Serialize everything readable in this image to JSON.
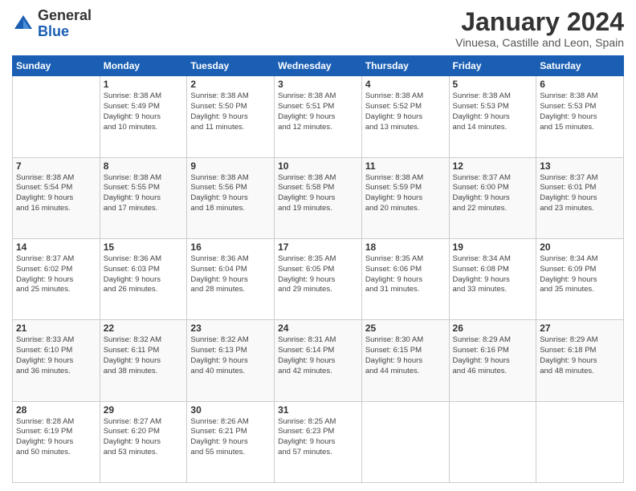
{
  "header": {
    "logo_general": "General",
    "logo_blue": "Blue",
    "month_year": "January 2024",
    "location": "Vinuesa, Castille and Leon, Spain"
  },
  "days_of_week": [
    "Sunday",
    "Monday",
    "Tuesday",
    "Wednesday",
    "Thursday",
    "Friday",
    "Saturday"
  ],
  "weeks": [
    [
      {
        "day": "",
        "info": ""
      },
      {
        "day": "1",
        "info": "Sunrise: 8:38 AM\nSunset: 5:49 PM\nDaylight: 9 hours\nand 10 minutes."
      },
      {
        "day": "2",
        "info": "Sunrise: 8:38 AM\nSunset: 5:50 PM\nDaylight: 9 hours\nand 11 minutes."
      },
      {
        "day": "3",
        "info": "Sunrise: 8:38 AM\nSunset: 5:51 PM\nDaylight: 9 hours\nand 12 minutes."
      },
      {
        "day": "4",
        "info": "Sunrise: 8:38 AM\nSunset: 5:52 PM\nDaylight: 9 hours\nand 13 minutes."
      },
      {
        "day": "5",
        "info": "Sunrise: 8:38 AM\nSunset: 5:53 PM\nDaylight: 9 hours\nand 14 minutes."
      },
      {
        "day": "6",
        "info": "Sunrise: 8:38 AM\nSunset: 5:53 PM\nDaylight: 9 hours\nand 15 minutes."
      }
    ],
    [
      {
        "day": "7",
        "info": "Sunrise: 8:38 AM\nSunset: 5:54 PM\nDaylight: 9 hours\nand 16 minutes."
      },
      {
        "day": "8",
        "info": "Sunrise: 8:38 AM\nSunset: 5:55 PM\nDaylight: 9 hours\nand 17 minutes."
      },
      {
        "day": "9",
        "info": "Sunrise: 8:38 AM\nSunset: 5:56 PM\nDaylight: 9 hours\nand 18 minutes."
      },
      {
        "day": "10",
        "info": "Sunrise: 8:38 AM\nSunset: 5:58 PM\nDaylight: 9 hours\nand 19 minutes."
      },
      {
        "day": "11",
        "info": "Sunrise: 8:38 AM\nSunset: 5:59 PM\nDaylight: 9 hours\nand 20 minutes."
      },
      {
        "day": "12",
        "info": "Sunrise: 8:37 AM\nSunset: 6:00 PM\nDaylight: 9 hours\nand 22 minutes."
      },
      {
        "day": "13",
        "info": "Sunrise: 8:37 AM\nSunset: 6:01 PM\nDaylight: 9 hours\nand 23 minutes."
      }
    ],
    [
      {
        "day": "14",
        "info": "Sunrise: 8:37 AM\nSunset: 6:02 PM\nDaylight: 9 hours\nand 25 minutes."
      },
      {
        "day": "15",
        "info": "Sunrise: 8:36 AM\nSunset: 6:03 PM\nDaylight: 9 hours\nand 26 minutes."
      },
      {
        "day": "16",
        "info": "Sunrise: 8:36 AM\nSunset: 6:04 PM\nDaylight: 9 hours\nand 28 minutes."
      },
      {
        "day": "17",
        "info": "Sunrise: 8:35 AM\nSunset: 6:05 PM\nDaylight: 9 hours\nand 29 minutes."
      },
      {
        "day": "18",
        "info": "Sunrise: 8:35 AM\nSunset: 6:06 PM\nDaylight: 9 hours\nand 31 minutes."
      },
      {
        "day": "19",
        "info": "Sunrise: 8:34 AM\nSunset: 6:08 PM\nDaylight: 9 hours\nand 33 minutes."
      },
      {
        "day": "20",
        "info": "Sunrise: 8:34 AM\nSunset: 6:09 PM\nDaylight: 9 hours\nand 35 minutes."
      }
    ],
    [
      {
        "day": "21",
        "info": "Sunrise: 8:33 AM\nSunset: 6:10 PM\nDaylight: 9 hours\nand 36 minutes."
      },
      {
        "day": "22",
        "info": "Sunrise: 8:32 AM\nSunset: 6:11 PM\nDaylight: 9 hours\nand 38 minutes."
      },
      {
        "day": "23",
        "info": "Sunrise: 8:32 AM\nSunset: 6:13 PM\nDaylight: 9 hours\nand 40 minutes."
      },
      {
        "day": "24",
        "info": "Sunrise: 8:31 AM\nSunset: 6:14 PM\nDaylight: 9 hours\nand 42 minutes."
      },
      {
        "day": "25",
        "info": "Sunrise: 8:30 AM\nSunset: 6:15 PM\nDaylight: 9 hours\nand 44 minutes."
      },
      {
        "day": "26",
        "info": "Sunrise: 8:29 AM\nSunset: 6:16 PM\nDaylight: 9 hours\nand 46 minutes."
      },
      {
        "day": "27",
        "info": "Sunrise: 8:29 AM\nSunset: 6:18 PM\nDaylight: 9 hours\nand 48 minutes."
      }
    ],
    [
      {
        "day": "28",
        "info": "Sunrise: 8:28 AM\nSunset: 6:19 PM\nDaylight: 9 hours\nand 50 minutes."
      },
      {
        "day": "29",
        "info": "Sunrise: 8:27 AM\nSunset: 6:20 PM\nDaylight: 9 hours\nand 53 minutes."
      },
      {
        "day": "30",
        "info": "Sunrise: 8:26 AM\nSunset: 6:21 PM\nDaylight: 9 hours\nand 55 minutes."
      },
      {
        "day": "31",
        "info": "Sunrise: 8:25 AM\nSunset: 6:23 PM\nDaylight: 9 hours\nand 57 minutes."
      },
      {
        "day": "",
        "info": ""
      },
      {
        "day": "",
        "info": ""
      },
      {
        "day": "",
        "info": ""
      }
    ]
  ]
}
